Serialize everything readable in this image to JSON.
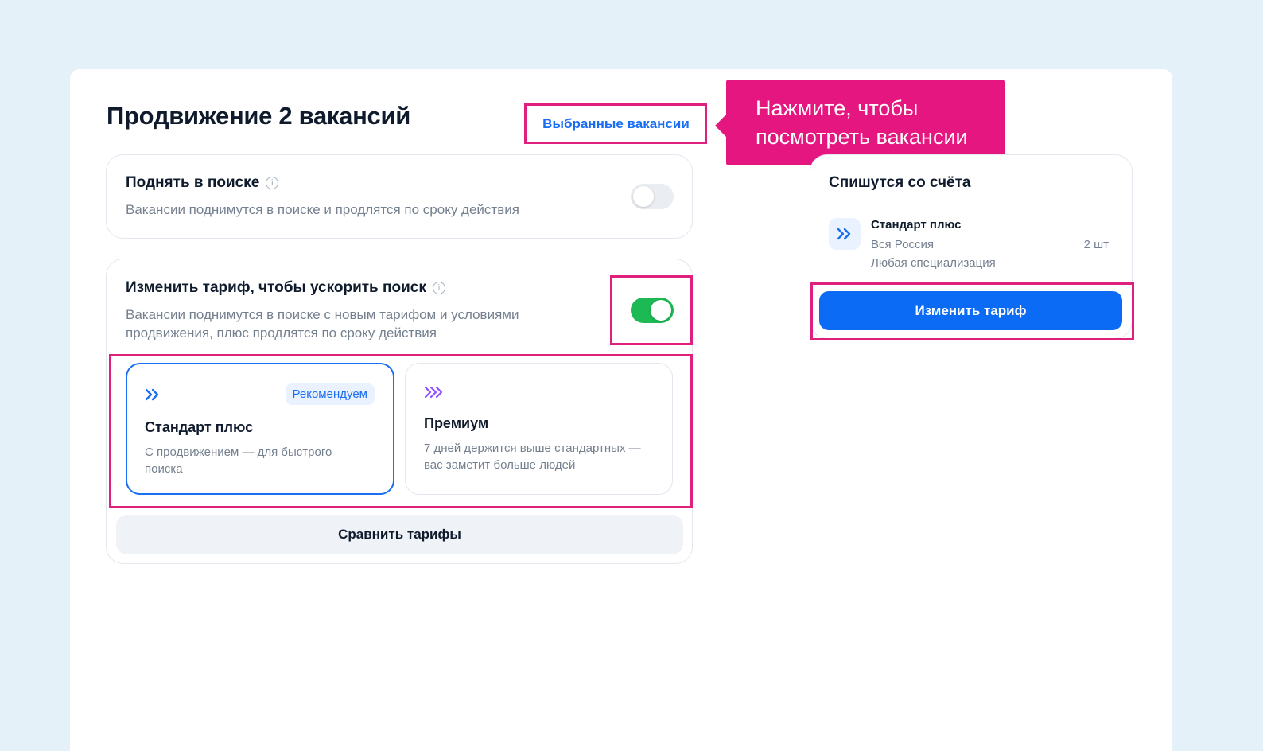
{
  "header": {
    "title": "Продвижение 2 вакансий",
    "selected_vacancies_link": "Выбранные вакансии"
  },
  "callout": {
    "line1": "Нажмите, чтобы",
    "line2": "посмотреть вакансии"
  },
  "raise_option": {
    "title": "Поднять в поиске",
    "description": "Вакансии поднимутся в поиске и продлятся по сроку действия",
    "enabled": false
  },
  "change_tariff_option": {
    "title": "Изменить тариф, чтобы ускорить поиск",
    "description_line1": "Вакансии поднимутся в поиске с новым тарифом и условиями",
    "description_line2": "продвижения, плюс продлятся по сроку действия",
    "enabled": true
  },
  "tariffs": [
    {
      "name": "Стандарт плюс",
      "badge": "Рекомендуем",
      "description_line1": "С продвижением — для быстрого",
      "description_line2": "поиска",
      "selected": true,
      "icon": "double-chevron-icon",
      "icon_color": "#1a6ef2"
    },
    {
      "name": "Премиум",
      "description_line1": "7 дней держится выше стандартных —",
      "description_line2": "вас заметит больше людей",
      "selected": false,
      "icon": "triple-chevron-icon",
      "icon_color": "#8a4fff"
    }
  ],
  "compare_button": "Сравнить тарифы",
  "summary": {
    "title": "Спишутся со счёта",
    "item_name": "Стандарт плюс",
    "region": "Вся Россия",
    "specialization": "Любая специализация",
    "quantity": "2 шт",
    "action_button": "Изменить тариф"
  },
  "colors": {
    "accent": "#1a6ef2",
    "toggle_on": "#1db954",
    "highlight": "#e0207e",
    "callout": "#e5167f"
  }
}
